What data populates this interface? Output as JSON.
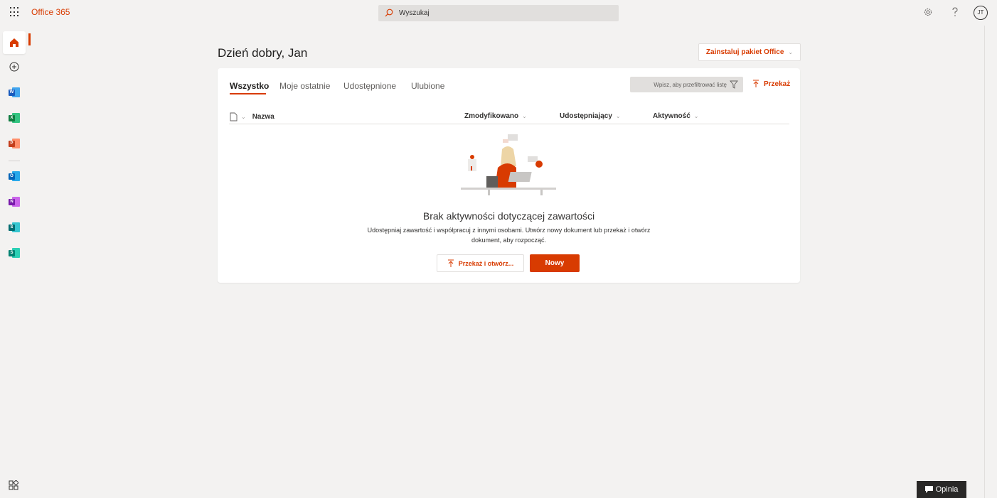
{
  "header": {
    "brand": "Office 365",
    "search_placeholder": "Wyszukaj",
    "avatar_initials": "JT"
  },
  "main": {
    "greeting": "Dzień dobry, Jan",
    "install_label": "Zainstaluj pakiet Office"
  },
  "tabs": [
    "Wszystko",
    "Moje ostatnie",
    "Udostępnione",
    "Ulubione"
  ],
  "filter_placeholder": "Wpisz, aby przefiltrować listę",
  "upload_label": "Przekaż",
  "columns": {
    "name": "Nazwa",
    "modified": "Zmodyfikowano",
    "shared_by": "Udostępniający",
    "activity": "Aktywność"
  },
  "empty": {
    "title": "Brak aktywności dotyczącej zawartości",
    "description": "Udostępniaj zawartość i współpracuj z innymi osobami. Utwórz nowy dokument lub przekaż i otwórz dokument, aby rozpocząć.",
    "upload_open_label": "Przekaż i otwórz...",
    "new_label": "Nowy"
  },
  "rail_apps": [
    {
      "name": "word",
      "letter": "W",
      "front": "#185abd",
      "back": "#41a5ee"
    },
    {
      "name": "excel",
      "letter": "X",
      "front": "#107c41",
      "back": "#33c481"
    },
    {
      "name": "powerpoint",
      "letter": "P",
      "front": "#c43e1c",
      "back": "#ff8f6b"
    },
    {
      "name": "outlook",
      "letter": "O",
      "front": "#0364b8",
      "back": "#28a8ea"
    },
    {
      "name": "onenote",
      "letter": "N",
      "front": "#7719aa",
      "back": "#ca64ea"
    },
    {
      "name": "sharepoint",
      "letter": "S",
      "front": "#036c70",
      "back": "#37c6d0"
    },
    {
      "name": "sway",
      "letter": "S",
      "front": "#008272",
      "back": "#2ccfb4"
    }
  ],
  "feedback_label": "Opinia",
  "colors": {
    "accent": "#d83b01",
    "background": "#f3f2f1"
  }
}
